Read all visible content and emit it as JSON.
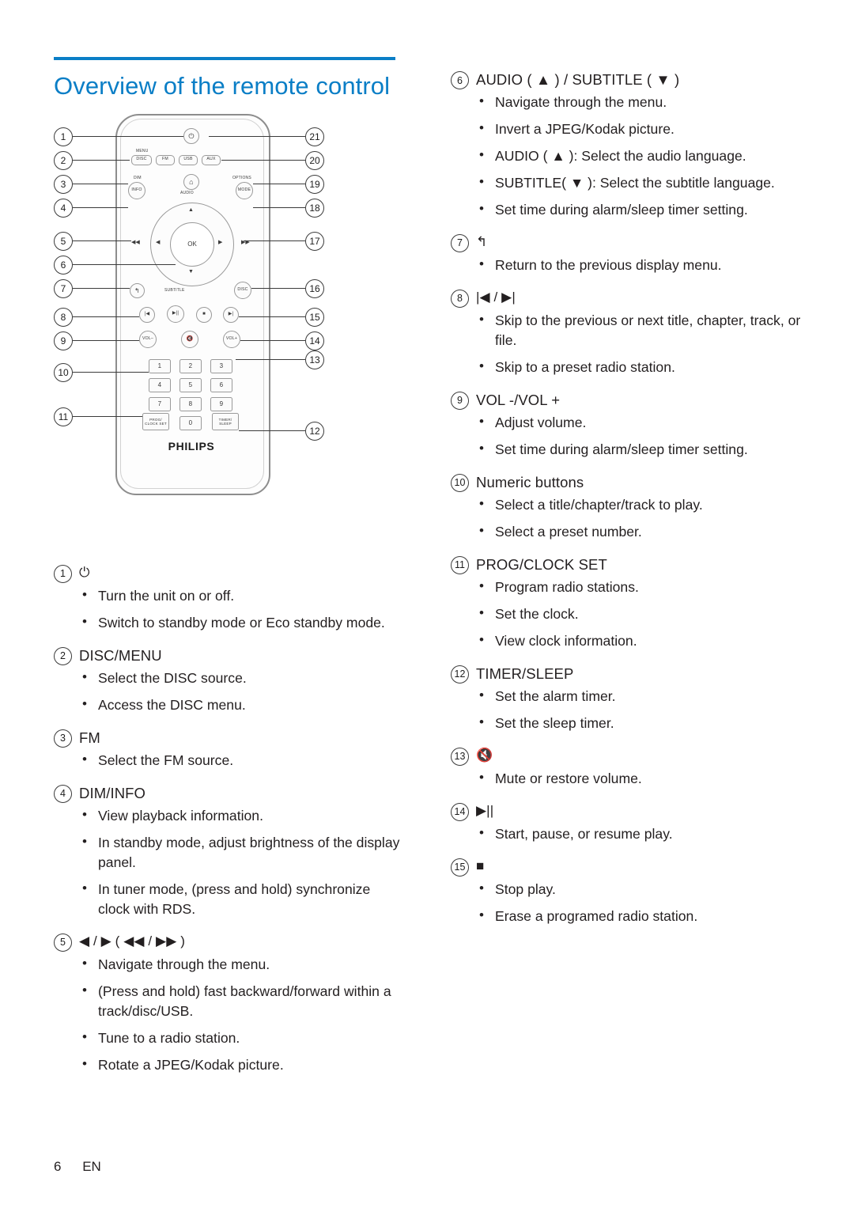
{
  "page": {
    "title": "Overview of the remote control",
    "footer_page": "6",
    "footer_lang": "EN",
    "accent_color": "#0a7ec6"
  },
  "remote": {
    "brand": "PHILIPS",
    "callouts_left": [
      "1",
      "2",
      "3",
      "4",
      "5",
      "6",
      "7",
      "8",
      "9",
      "10",
      "11"
    ],
    "callouts_right": [
      "21",
      "20",
      "19",
      "18",
      "17",
      "16",
      "15",
      "14",
      "13",
      "12"
    ],
    "buttons": {
      "power": "⏻",
      "menu": "MENU",
      "disc": "DISC",
      "fm": "FM",
      "usb": "USB",
      "aux": "AUX",
      "dim": "DIM",
      "info": "INFO",
      "home": "⌂",
      "options": "OPTIONS",
      "mode": "MODE",
      "audio": "AUDIO",
      "ok": "OK",
      "up": "▲",
      "down": "▼",
      "left": "◀◀",
      "right": "▶▶",
      "nav_left": "◀",
      "nav_right": "▶",
      "back": "↰",
      "subtitle": "SUBTITLE",
      "disc2": "DISC",
      "prev": "|◀",
      "play_pause": "▶||",
      "stop": "■",
      "next": "▶|",
      "vol_minus": "VOL–",
      "mute": "🔇",
      "vol_plus": "VOL+",
      "num1": "1",
      "num2": "2",
      "num3": "3",
      "num4": "4",
      "num5": "5",
      "num6": "6",
      "num7": "7",
      "num8": "8",
      "num9": "9",
      "num0": "0",
      "prog_clock_set": "PROG/ CLOCK SET",
      "timer_sleep": "TIMER/ SLEEP"
    }
  },
  "items_left": [
    {
      "num": "1",
      "label": "⏻",
      "is_glyph": true,
      "bullets": [
        "Turn the unit on or off.",
        "Switch to standby mode or Eco standby mode."
      ]
    },
    {
      "num": "2",
      "label": "DISC/MENU",
      "is_glyph": false,
      "bullets": [
        "Select the DISC source.",
        "Access the DISC menu."
      ]
    },
    {
      "num": "3",
      "label": "FM",
      "is_glyph": false,
      "bullets": [
        "Select the FM source."
      ]
    },
    {
      "num": "4",
      "label": "DIM/INFO",
      "is_glyph": false,
      "bullets": [
        "View playback information.",
        "In standby mode, adjust brightness of the display panel.",
        "In tuner mode, (press and hold) synchronize clock with RDS."
      ]
    },
    {
      "num": "5",
      "label": "◀ / ▶ ( ◀◀ / ▶▶ )",
      "is_glyph": true,
      "bullets": [
        "Navigate through the menu.",
        "(Press and hold) fast backward/forward within a track/disc/USB.",
        "Tune to a radio station.",
        "Rotate a JPEG/Kodak picture."
      ]
    }
  ],
  "items_right": [
    {
      "num": "6",
      "label": "AUDIO ( ▲ ) / SUBTITLE ( ▼ )",
      "is_glyph": false,
      "bullets": [
        "Navigate through the menu.",
        "Invert a JPEG/Kodak picture.",
        "AUDIO ( ▲ ): Select the audio language.",
        "SUBTITLE( ▼ ): Select the subtitle language.",
        "Set time during alarm/sleep timer setting."
      ]
    },
    {
      "num": "7",
      "label": "↰",
      "is_glyph": true,
      "bullets": [
        "Return to the previous display menu."
      ]
    },
    {
      "num": "8",
      "label": "|◀ / ▶|",
      "is_glyph": true,
      "bullets": [
        "Skip to the previous or next title, chapter, track, or file.",
        "Skip to a preset radio station."
      ]
    },
    {
      "num": "9",
      "label": "VOL -/VOL +",
      "is_glyph": false,
      "bullets": [
        "Adjust volume.",
        "Set time during alarm/sleep timer setting."
      ]
    },
    {
      "num": "10",
      "label": "Numeric buttons",
      "is_glyph": false,
      "bullets": [
        "Select a title/chapter/track to play.",
        "Select a preset number."
      ]
    },
    {
      "num": "11",
      "label": "PROG/CLOCK SET",
      "is_glyph": false,
      "bullets": [
        "Program radio stations.",
        "Set the clock.",
        "View clock information."
      ]
    },
    {
      "num": "12",
      "label": "TIMER/SLEEP",
      "is_glyph": false,
      "bullets": [
        "Set the alarm timer.",
        "Set the sleep timer."
      ]
    },
    {
      "num": "13",
      "label": "🔇",
      "is_glyph": true,
      "bullets": [
        "Mute or restore volume."
      ]
    },
    {
      "num": "14",
      "label": "▶||",
      "is_glyph": true,
      "bullets": [
        "Start, pause, or resume play."
      ]
    },
    {
      "num": "15",
      "label": "■",
      "is_glyph": true,
      "bullets": [
        "Stop play.",
        "Erase a programed radio station."
      ]
    }
  ]
}
